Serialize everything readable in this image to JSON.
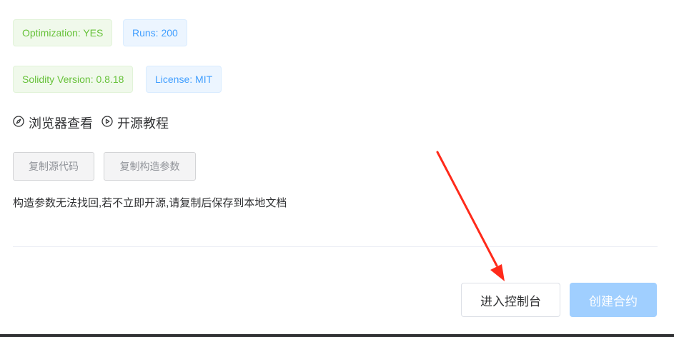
{
  "tags": {
    "optimization": "Optimization: YES",
    "runs": "Runs: 200",
    "solidity_version": "Solidity Version: 0.8.18",
    "license": "License: MIT"
  },
  "links": {
    "browser_view": "浏览器查看",
    "open_source_tutorial": "开源教程"
  },
  "actions": {
    "copy_source": "复制源代码",
    "copy_constructor_args": "复制构造参数"
  },
  "warning_text": "构造参数无法找回,若不立即开源,请复制后保存到本地文档",
  "footer": {
    "enter_console": "进入控制台",
    "create_contract": "创建合约"
  },
  "colors": {
    "green_tag": "#67c23a",
    "blue_tag": "#409eff",
    "primary_disabled": "#a0cfff",
    "annotation_arrow": "#ff2a1a"
  },
  "icons": {
    "browser_view": "compass-icon",
    "open_source_tutorial": "play-circle-icon"
  }
}
